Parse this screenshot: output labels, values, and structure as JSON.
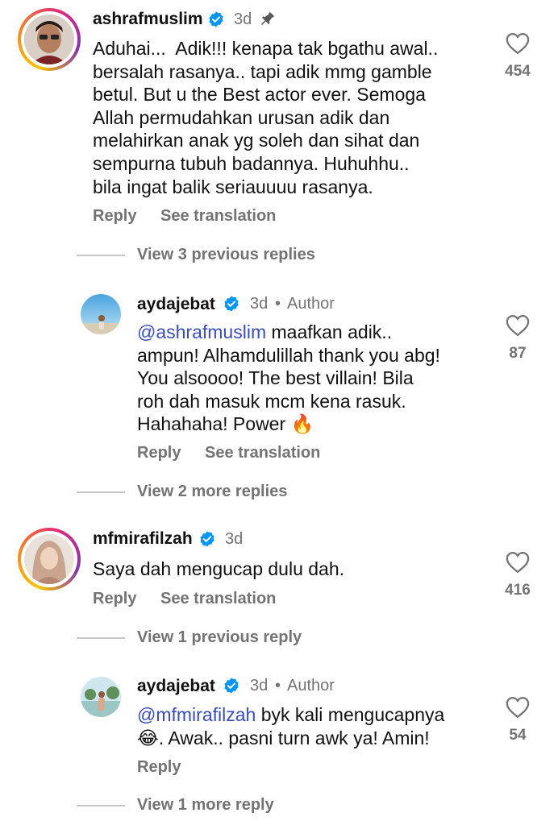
{
  "comments": [
    {
      "username": "ashrafmuslim",
      "time": "3d",
      "text": "Aduhai...  Adik!!! kenapa tak bgathu awal..\nbersalah rasanya.. tapi adik mmg gamble\nbetul. But u the Best actor ever. Semoga\nAllah permudahkan urusan adik dan\nmelahirkan anak yg soleh dan sihat dan\nsempurna tubuh badannya. Huhuhhu..\nbila ingat balik seriauuuu rasanya.",
      "likes": "454",
      "reply_label": "Reply",
      "translate_label": "See translation",
      "view_replies": "View 3 previous replies"
    },
    {
      "username": "aydajebat",
      "time": "3d",
      "author_label": "Author",
      "mention": "@ashrafmuslim",
      "text": " maafkan adik..\nampun! Alhamdulillah thank you abg!\nYou alsoooo! The best villain! Bila\nroh dah masuk mcm kena rasuk.\nHahahaha! Power 🔥",
      "likes": "87",
      "reply_label": "Reply",
      "translate_label": "See translation",
      "view_replies": "View 2 more replies"
    },
    {
      "username": "mfmirafilzah",
      "time": "3d",
      "text": "Saya dah mengucap dulu dah.",
      "likes": "416",
      "reply_label": "Reply",
      "translate_label": "See translation",
      "view_replies": "View 1 previous reply"
    },
    {
      "username": "aydajebat",
      "time": "3d",
      "author_label": "Author",
      "mention": "@mfmirafilzah",
      "text": " byk kali mengucapnya\n😂. Awak.. pasni turn awk ya! Amin!",
      "likes": "54",
      "reply_label": "Reply",
      "view_replies": "View 1 more reply"
    }
  ],
  "dot_separator": "•",
  "colors": {
    "verified": "#0095f6",
    "mention": "#3a4db8",
    "secondary": "#737373"
  },
  "icons": [
    "verified-badge-icon",
    "pin-icon",
    "heart-icon"
  ]
}
